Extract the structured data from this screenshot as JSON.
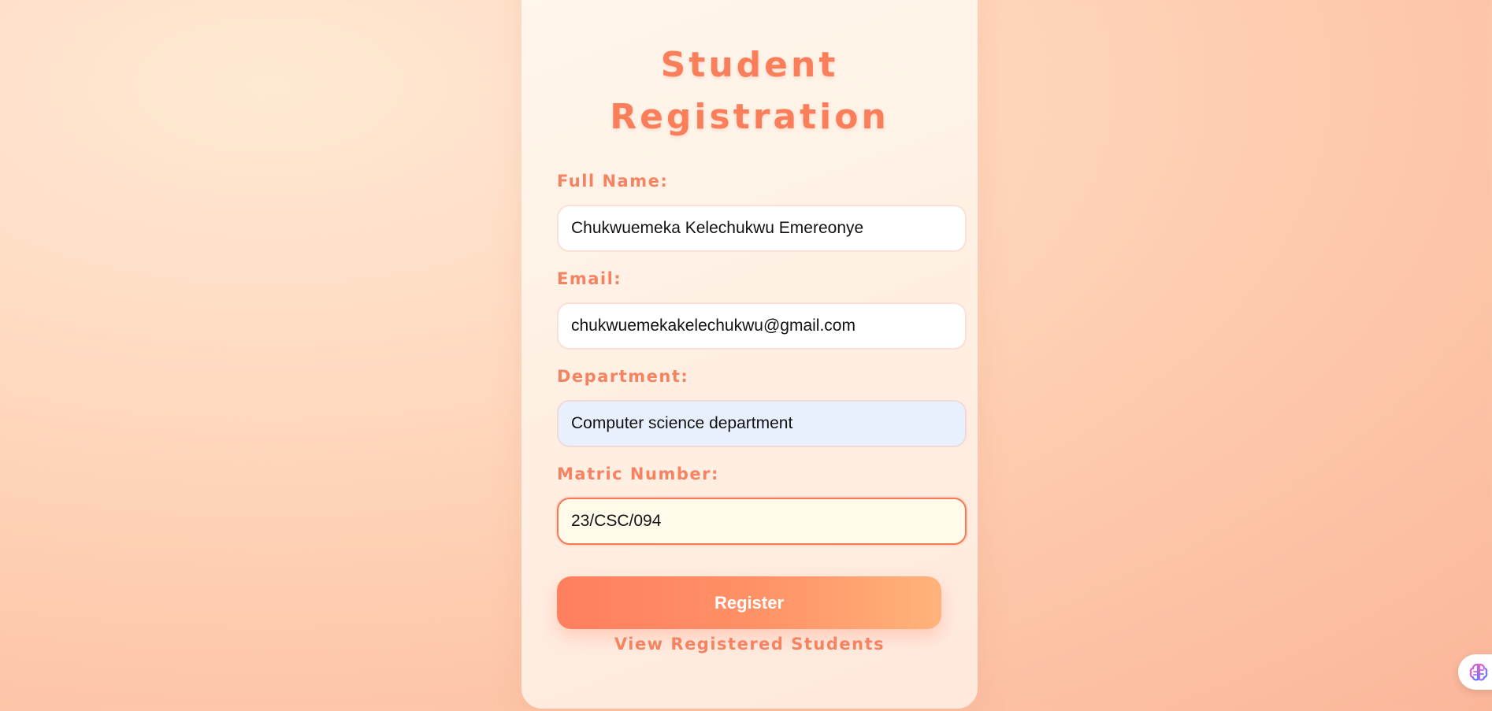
{
  "form": {
    "title_line1": "Student",
    "title_line2": "Registration",
    "full_name_label": "Full Name:",
    "full_name_value": "Chukwuemeka Kelechukwu Emereonye",
    "email_label": "Email:",
    "email_value": "chukwuemekakelechukwu@gmail.com",
    "department_label": "Department:",
    "department_value": "Computer science department",
    "matric_label": "Matric Number:",
    "matric_value": "23/CSC/094",
    "register_label": "Register",
    "view_link_label": "View Registered Students"
  },
  "extension": {
    "icon": "brain-icon"
  },
  "colors": {
    "accent": "#fb7e5b",
    "button_start": "#ff7f5e",
    "button_end": "#ffb37a",
    "autofill_bg": "#e8f0fe",
    "focused_border": "#f47a55"
  }
}
